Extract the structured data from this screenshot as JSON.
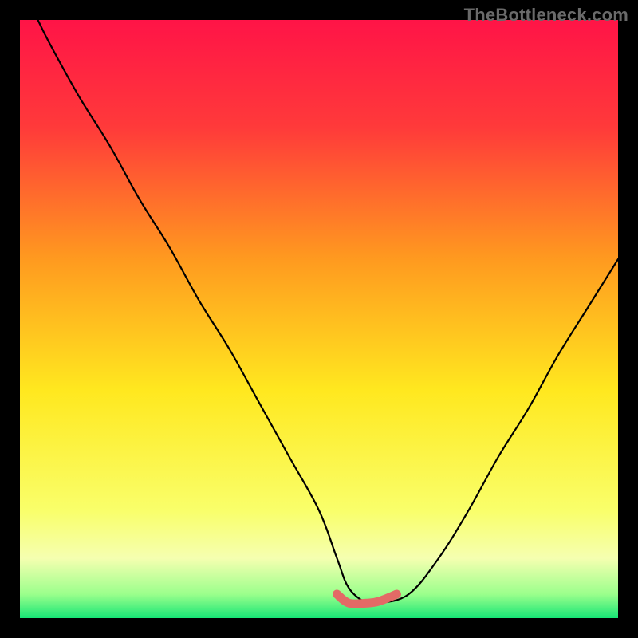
{
  "watermark": "TheBottleneck.com",
  "colors": {
    "bg_black": "#000000",
    "grad_top": "#ff1447",
    "grad_orange": "#ff9a1f",
    "grad_yellow": "#ffe81f",
    "grad_pale": "#f5ffb0",
    "grad_green": "#18e676",
    "curve": "#000000",
    "highlight": "#e36a66"
  },
  "chart_data": {
    "type": "line",
    "title": "",
    "xlabel": "",
    "ylabel": "",
    "xlim": [
      0,
      100
    ],
    "ylim": [
      0,
      100
    ],
    "series": [
      {
        "name": "bottleneck-curve",
        "x": [
          3,
          5,
          10,
          15,
          20,
          25,
          30,
          35,
          40,
          45,
          50,
          53,
          55,
          58,
          60,
          65,
          70,
          75,
          80,
          85,
          90,
          95,
          100
        ],
        "y": [
          100,
          96,
          87,
          79,
          70,
          62,
          53,
          45,
          36,
          27,
          18,
          10,
          5,
          2.5,
          2.5,
          4,
          10,
          18,
          27,
          35,
          44,
          52,
          60
        ]
      },
      {
        "name": "bottom-highlight",
        "x": [
          53,
          55,
          58,
          60,
          63
        ],
        "y": [
          4,
          2.5,
          2.5,
          2.8,
          4
        ]
      }
    ],
    "gradient_stops": [
      {
        "offset": 0.0,
        "color": "#ff1447"
      },
      {
        "offset": 0.18,
        "color": "#ff3a3a"
      },
      {
        "offset": 0.4,
        "color": "#ff9a1f"
      },
      {
        "offset": 0.62,
        "color": "#ffe81f"
      },
      {
        "offset": 0.82,
        "color": "#f9ff6a"
      },
      {
        "offset": 0.9,
        "color": "#f5ffb0"
      },
      {
        "offset": 0.96,
        "color": "#9bff8c"
      },
      {
        "offset": 1.0,
        "color": "#18e676"
      }
    ]
  }
}
